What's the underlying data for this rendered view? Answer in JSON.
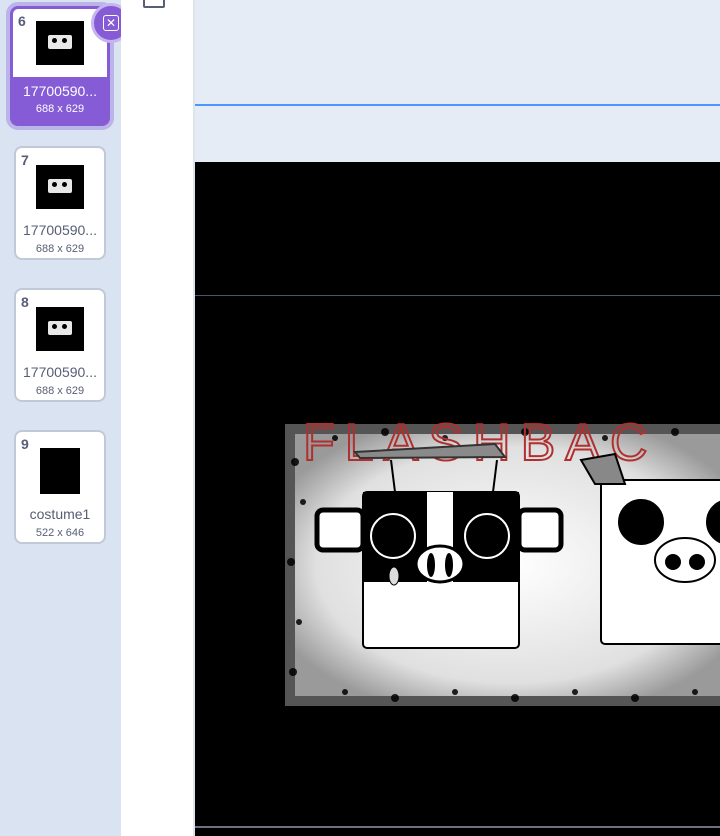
{
  "costumes": [
    {
      "number": "6",
      "name": "17700590...",
      "size": "688 x 629",
      "selected": true
    },
    {
      "number": "7",
      "name": "17700590...",
      "size": "688 x 629",
      "selected": false
    },
    {
      "number": "8",
      "name": "17700590...",
      "size": "688 x 629",
      "selected": false
    },
    {
      "number": "9",
      "name": "costume1",
      "size": "522 x 646",
      "selected": false
    }
  ],
  "delete_icon": "close-icon",
  "canvas": {
    "artwork_text": "FLASHBAC"
  },
  "colors": {
    "selection_purple": "#855cd6",
    "guide_blue": "#4c97ff",
    "art_red": "#b0302f"
  }
}
